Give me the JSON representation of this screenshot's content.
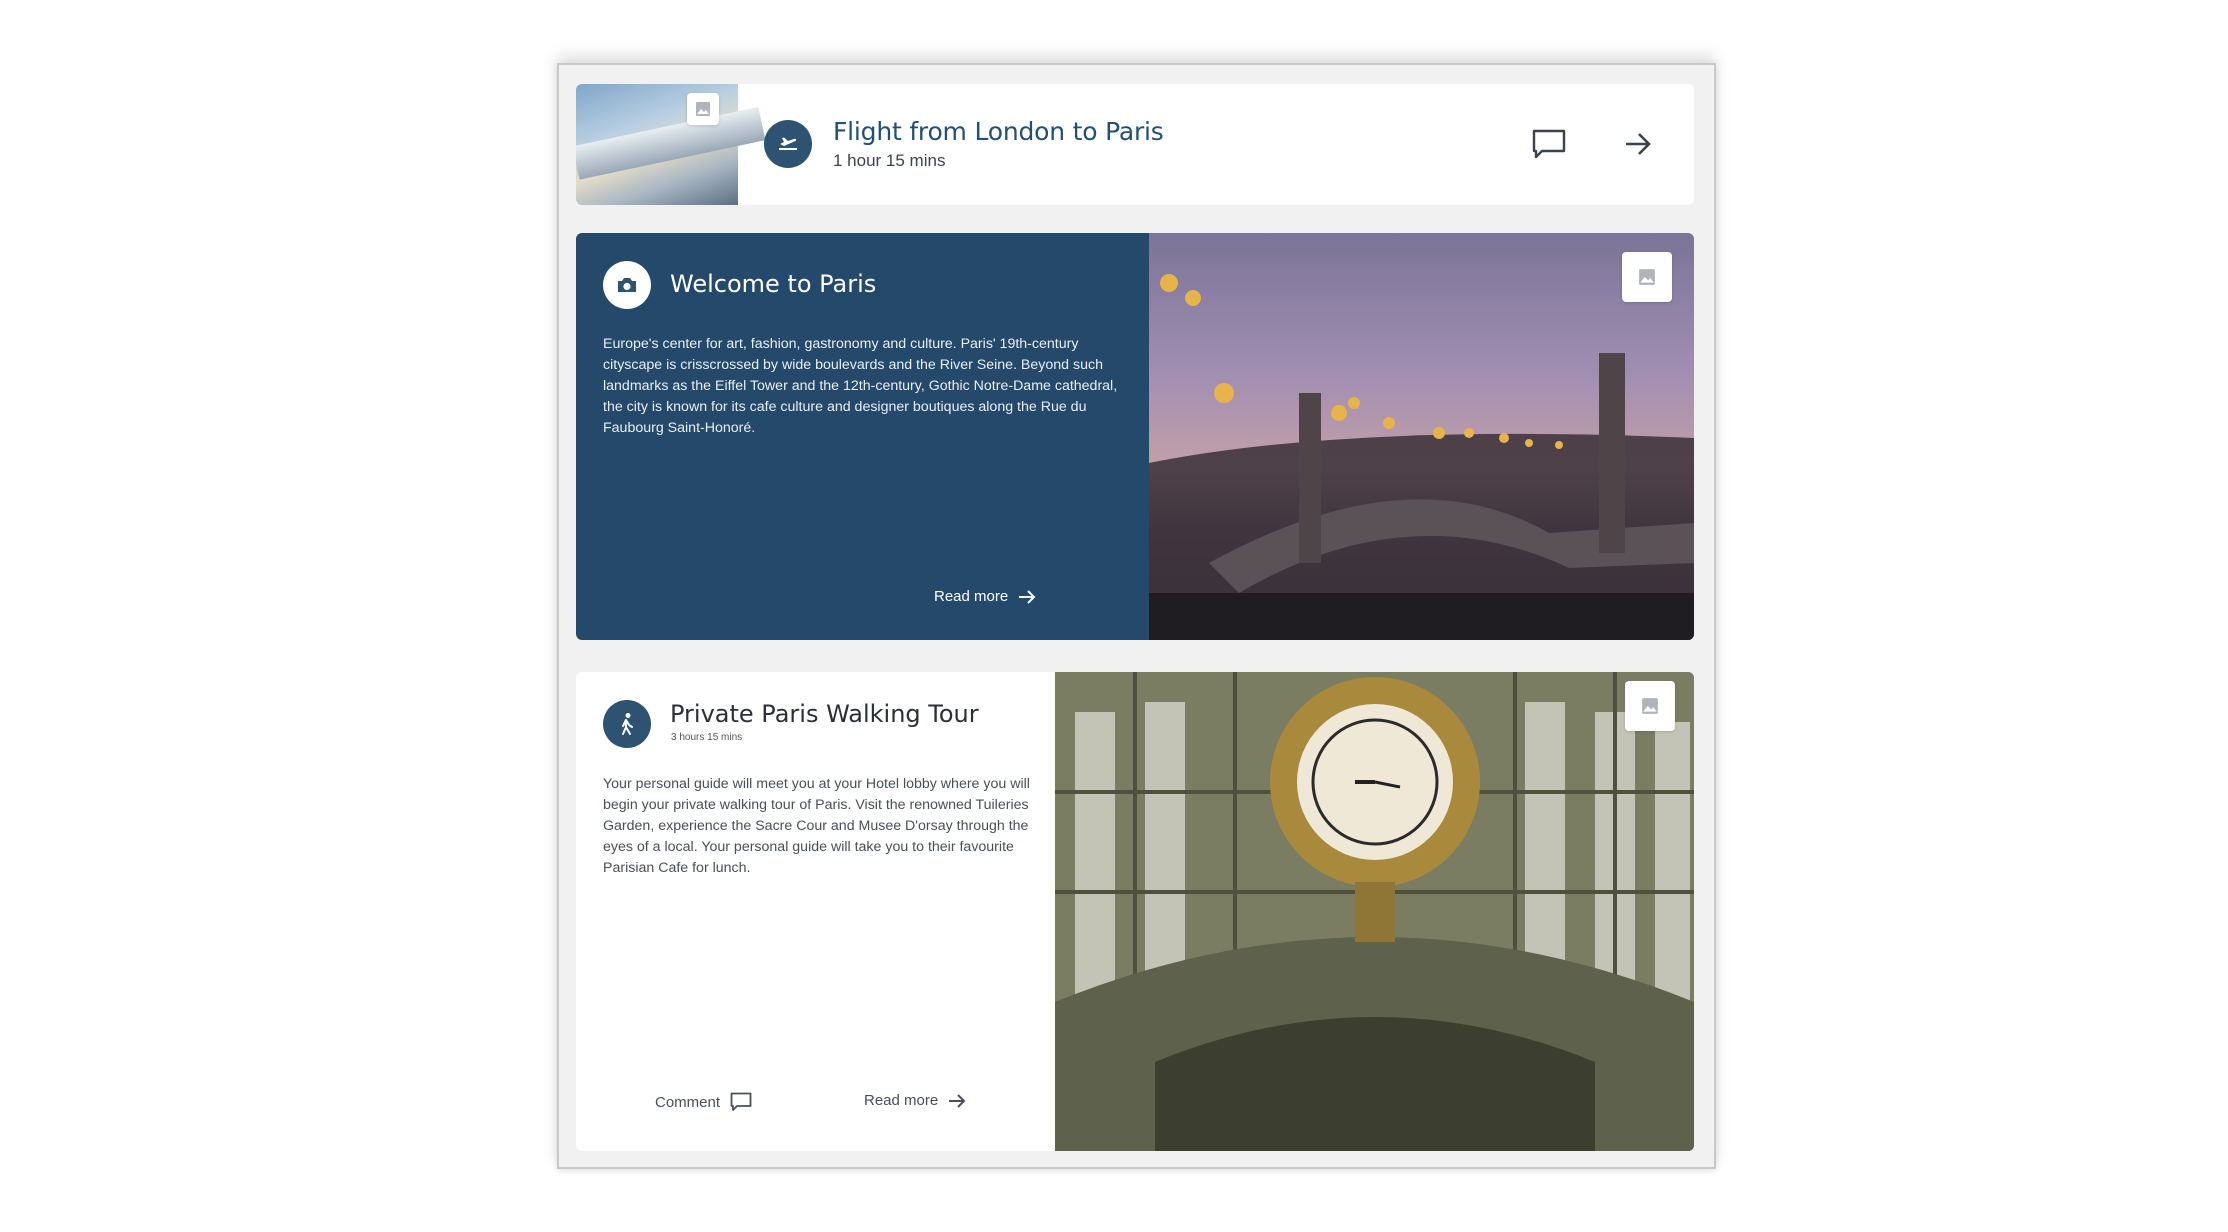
{
  "flight": {
    "title": "Flight from London to Paris",
    "duration": "1 hour 15 mins",
    "icons": [
      "image-icon",
      "plane-departure-icon",
      "comment-icon",
      "arrow-right-icon"
    ]
  },
  "welcome": {
    "title": "Welcome to Paris",
    "body": "Europe's center for art, fashion, gastronomy and culture. Paris' 19th-century cityscape is crisscrossed by wide boulevards and the River Seine. Beyond such landmarks as the Eiffel Tower and the 12th-century, Gothic Notre-Dame cathedral, the city is known for its cafe culture and designer boutiques along the Rue du Faubourg Saint-Honoré.",
    "read_more": "Read more",
    "icons": [
      "camera-icon",
      "image-icon",
      "arrow-right-icon"
    ]
  },
  "tour": {
    "title": "Private Paris Walking Tour",
    "duration": "3 hours 15 mins",
    "body": "Your personal guide will meet you at your Hotel lobby where you will begin your private walking tour of Paris. Visit the renowned Tuileries Garden, experience the Sacre Cour and Musee D'orsay through the eyes of a local. Your personal guide will take you to their favourite Parisian Cafe for lunch.",
    "comment": "Comment",
    "read_more": "Read more",
    "icons": [
      "walking-person-icon",
      "image-icon",
      "comment-icon",
      "arrow-right-icon"
    ]
  },
  "colors": {
    "primary": "#24496a",
    "icon_circle": "#2d5272",
    "title_blue": "#24506f"
  }
}
